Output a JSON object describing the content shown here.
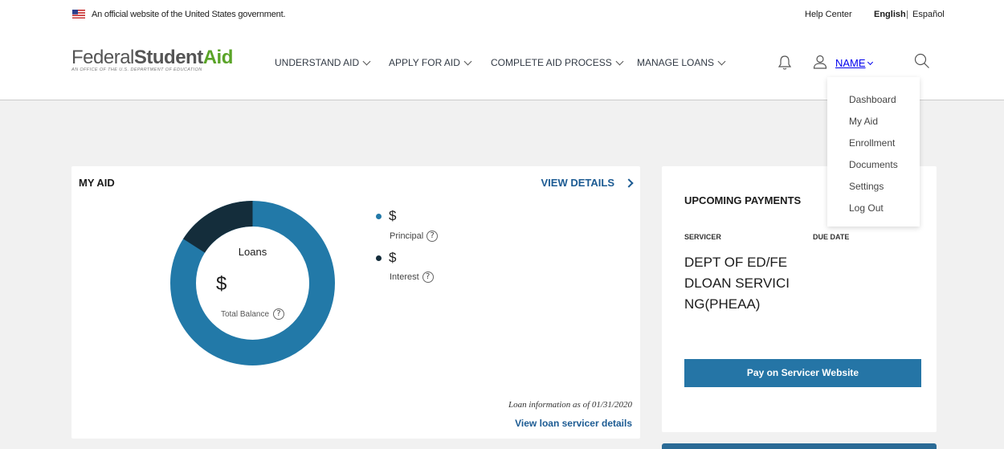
{
  "gov_banner": {
    "official_text": "An official website of the United States government.",
    "help_center": "Help Center",
    "lang_english": "English",
    "lang_separator": "|",
    "lang_spanish": "Español"
  },
  "header": {
    "logo_federal": "Federal",
    "logo_student": "Student",
    "logo_aid": "Aid",
    "logo_subtitle": "An OFFICE of the U.S. DEPARTMENT of EDUCATION",
    "nav": [
      {
        "label": "UNDERSTAND AID"
      },
      {
        "label": "APPLY FOR AID"
      },
      {
        "label": "COMPLETE AID PROCESS"
      },
      {
        "label": "MANAGE LOANS"
      }
    ],
    "user_name": "NAME",
    "icons": {
      "bell": "bell-icon",
      "user": "user-icon",
      "search": "search-icon"
    }
  },
  "user_menu": {
    "items": [
      {
        "label": "Dashboard"
      },
      {
        "label": "My Aid"
      },
      {
        "label": "Enrollment"
      },
      {
        "label": "Documents"
      },
      {
        "label": "Settings"
      },
      {
        "label": "Log Out"
      }
    ]
  },
  "my_aid": {
    "title": "MY AID",
    "view_details": "VIEW DETAILS",
    "donut_label": "Loans",
    "total_value": "$",
    "total_label": "Total Balance",
    "help_glyph": "?",
    "breakdown": [
      {
        "value": "$",
        "label": "Principal",
        "color": "#2279a8",
        "share": 0.84
      },
      {
        "value": "$",
        "label": "Interest",
        "color": "#142d3b",
        "share": 0.16
      }
    ],
    "as_of": "Loan information as of 01/31/2020",
    "servicer_link": "View loan servicer details"
  },
  "upcoming_payments": {
    "title": "UPCOMING PAYMENTS",
    "col_servicer": "SERVICER",
    "col_due_date": "DUE DATE",
    "servicer_name": "DEPT OF ED/FEDLOAN SERVICING(PHEAA)",
    "pay_button": "Pay on Servicer Website"
  },
  "colors": {
    "primary": "#2575a6",
    "link": "#1c5b93",
    "brand_green": "#5aa428",
    "page_bg": "#f1f1f1"
  }
}
